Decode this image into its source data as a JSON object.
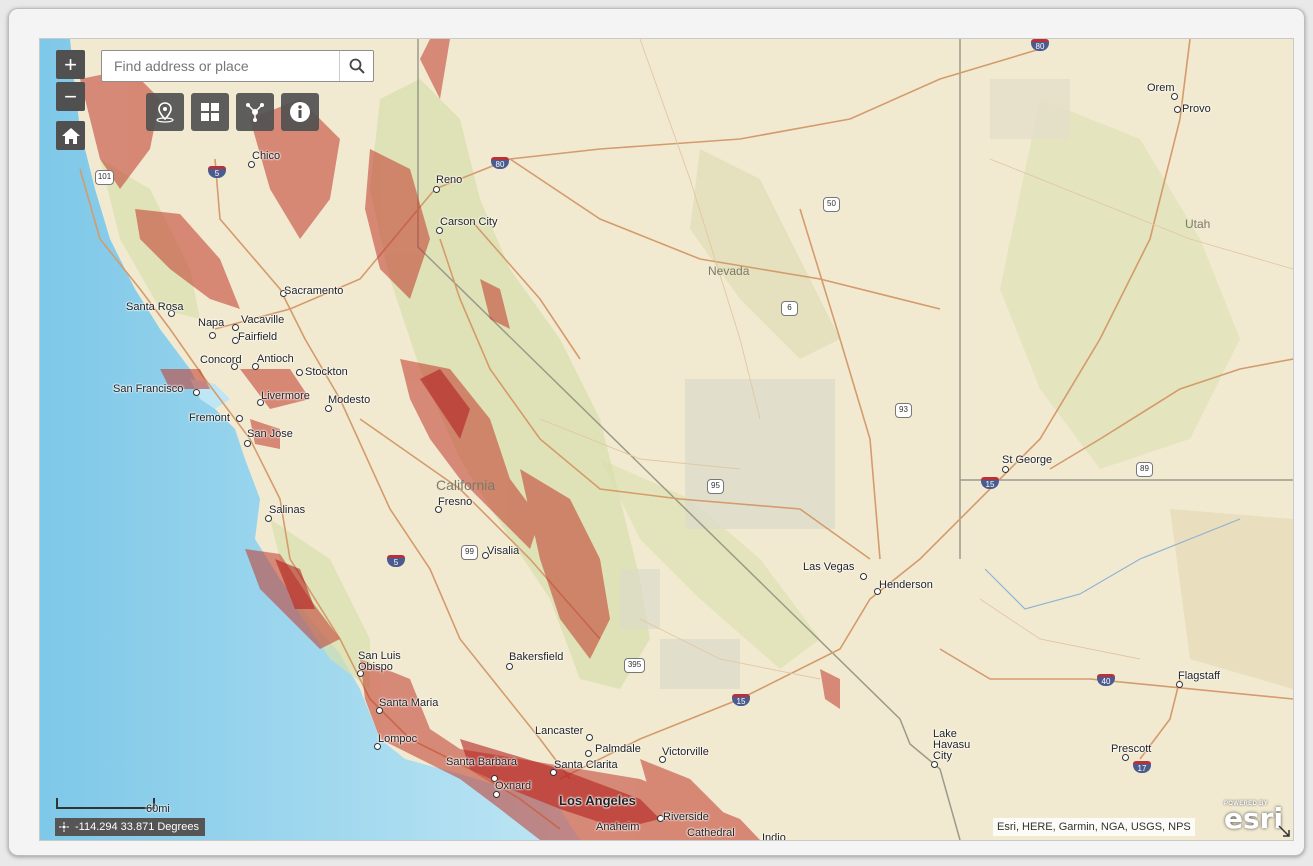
{
  "search": {
    "placeholder": "Find address or place"
  },
  "controls": {
    "zoom_in": "+",
    "zoom_out": "−"
  },
  "scale": {
    "label": "60mi"
  },
  "coordinates": {
    "text": "-114.294 33.871 Degrees"
  },
  "attribution": {
    "text": "Esri, HERE, Garmin, NGA, USGS, NPS"
  },
  "esri_logo": {
    "powered_by": "POWERED BY",
    "logo_text": "esri"
  },
  "colors": {
    "hazard_red": "#c0392b",
    "land": "#f2ead0",
    "water": "#9fd4ea",
    "control_bg": "#505050"
  },
  "map_labels": {
    "chico": "Chico",
    "reno": "Reno",
    "carson_city": "Carson City",
    "sacramento": "Sacramento",
    "santa_rosa": "Santa Rosa",
    "napa": "Napa",
    "vacaville": "Vacaville",
    "fairfield": "Fairfield",
    "concord": "Concord",
    "antioch": "Antioch",
    "stockton": "Stockton",
    "san_francisco": "San Francisco",
    "livermore": "Livermore",
    "modesto": "Modesto",
    "fremont": "Fremont",
    "san_jose": "San Jose",
    "california": "California",
    "fresno": "Fresno",
    "salinas": "Salinas",
    "visalia": "Visalia",
    "san_luis_obispo_1": "San Luis",
    "san_luis_obispo_2": "Obispo",
    "bakersfield": "Bakersfield",
    "santa_maria": "Santa Maria",
    "lompoc": "Lompoc",
    "lancaster": "Lancaster",
    "palmdale": "Palmdale",
    "victorville": "Victorville",
    "santa_barbara": "Santa Barbara",
    "santa_clarita": "Santa Clarita",
    "oxnard": "Oxnard",
    "los_angeles": "Los Angeles",
    "riverside": "Riverside",
    "anaheim": "Anaheim",
    "cathedral": "Cathedral",
    "indio": "Indio",
    "nevada": "Nevada",
    "las_vegas": "Las Vegas",
    "henderson": "Henderson",
    "orem": "Orem",
    "provo": "Provo",
    "utah": "Utah",
    "st_george": "St George",
    "lake_havasu_1": "Lake",
    "lake_havasu_2": "Havasu",
    "lake_havasu_3": "City",
    "prescott": "Prescott",
    "flagstaff": "Flagstaff"
  },
  "shields": {
    "i80a": "80",
    "i80b": "80",
    "i5a": "5",
    "i5b": "5",
    "i15a": "15",
    "i15b": "15",
    "i40": "40",
    "i17": "17",
    "us50": "50",
    "us6": "6",
    "us93": "93",
    "us95": "95",
    "us395": "395",
    "us99": "99",
    "us89": "89",
    "us101": "101"
  }
}
